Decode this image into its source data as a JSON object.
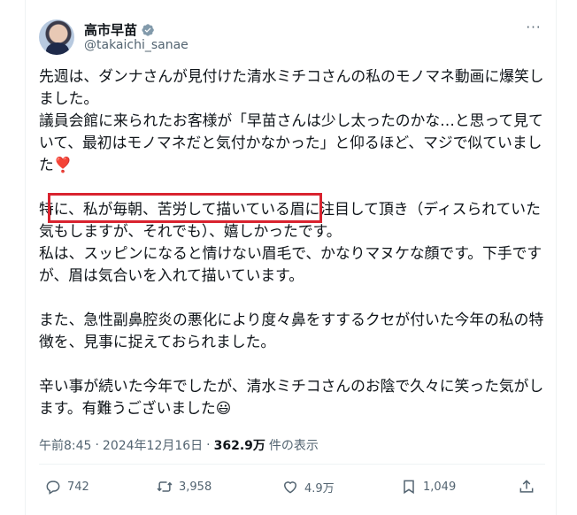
{
  "author": {
    "name": "高市早苗",
    "handle": "@takaichi_sanae"
  },
  "post": {
    "paragraphs": [
      "先週は、ダンナさんが見付けた清水ミチコさんの私のモノマネ動画に爆笑しました。\n議員会館に来られたお客様が「早苗さんは少し太ったのかな…と思って見ていて、最初はモノマネだと気付かなかった」と仰るほど、マジで似ていました❣️",
      "特に、私が毎朝、苦労して描いている眉に注目して頂き（ディスられていた気もしますが、それでも）、嬉しかったです。\n私は、スッピンになると情けない眉毛で、かなりマヌケな顔です。下手ですが、眉は気合いを入れて描いています。",
      "また、急性副鼻腔炎の悪化により度々鼻をすするクセが付いた今年の私の特徴を、見事に捉えておられました。",
      "辛い事が続いた今年でしたが、清水ミチコさんのお陰で久々に笑った気がします。有難うございました😃"
    ]
  },
  "meta": {
    "time": "午前8:45",
    "separator": "·",
    "date": "2024年12月16日",
    "views": "362.9万",
    "views_label": "件の表示"
  },
  "actions": {
    "replies": "742",
    "reposts": "3,958",
    "likes": "4.9万",
    "bookmarks": "1,049"
  },
  "icons": [
    "verified-badge-icon",
    "more-icon",
    "reply-icon",
    "repost-icon",
    "like-icon",
    "bookmark-icon",
    "share-icon"
  ],
  "colors": {
    "text": "#0f1419",
    "secondary": "#536471",
    "highlight_box": "#d9232f",
    "verified": "#829aab"
  }
}
